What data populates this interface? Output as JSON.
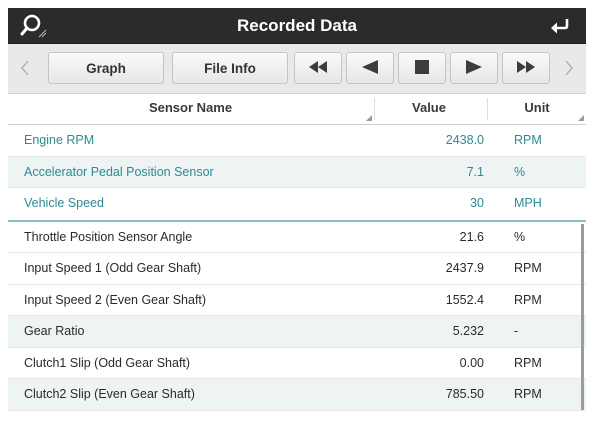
{
  "titlebar": {
    "title": "Recorded Data",
    "left_icon": "magnify-icon",
    "right_icon": "return-arrow-icon"
  },
  "toolbar": {
    "graph_label": "Graph",
    "file_info_label": "File Info",
    "controls": [
      "rewind-icon",
      "step-back-icon",
      "stop-icon",
      "play-icon",
      "fast-forward-icon"
    ]
  },
  "table": {
    "headers": {
      "name": "Sensor Name",
      "value": "Value",
      "unit": "Unit"
    },
    "pinned_rows": [
      {
        "name": "Engine RPM",
        "value": "2438.0",
        "unit": "RPM"
      },
      {
        "name": "Accelerator Pedal Position Sensor",
        "value": "7.1",
        "unit": "%"
      },
      {
        "name": "Vehicle Speed",
        "value": "30",
        "unit": "MPH"
      }
    ],
    "rows": [
      {
        "name": "Throttle Position Sensor Angle",
        "value": "21.6",
        "unit": "%"
      },
      {
        "name": "Input Speed 1 (Odd Gear Shaft)",
        "value": "2437.9",
        "unit": "RPM"
      },
      {
        "name": "Input Speed 2 (Even Gear Shaft)",
        "value": "1552.4",
        "unit": "RPM"
      },
      {
        "name": "Gear Ratio",
        "value": "5.232",
        "unit": "-"
      },
      {
        "name": "Clutch1 Slip (Odd Gear Shaft)",
        "value": "0.00",
        "unit": "RPM"
      },
      {
        "name": "Clutch2 Slip (Even Gear Shaft)",
        "value": "785.50",
        "unit": "RPM"
      }
    ]
  },
  "colors": {
    "titlebar_bg": "#2b2b2b",
    "pinned_text": "#2d8a92",
    "alt_row_bg": "#eef4f4"
  }
}
